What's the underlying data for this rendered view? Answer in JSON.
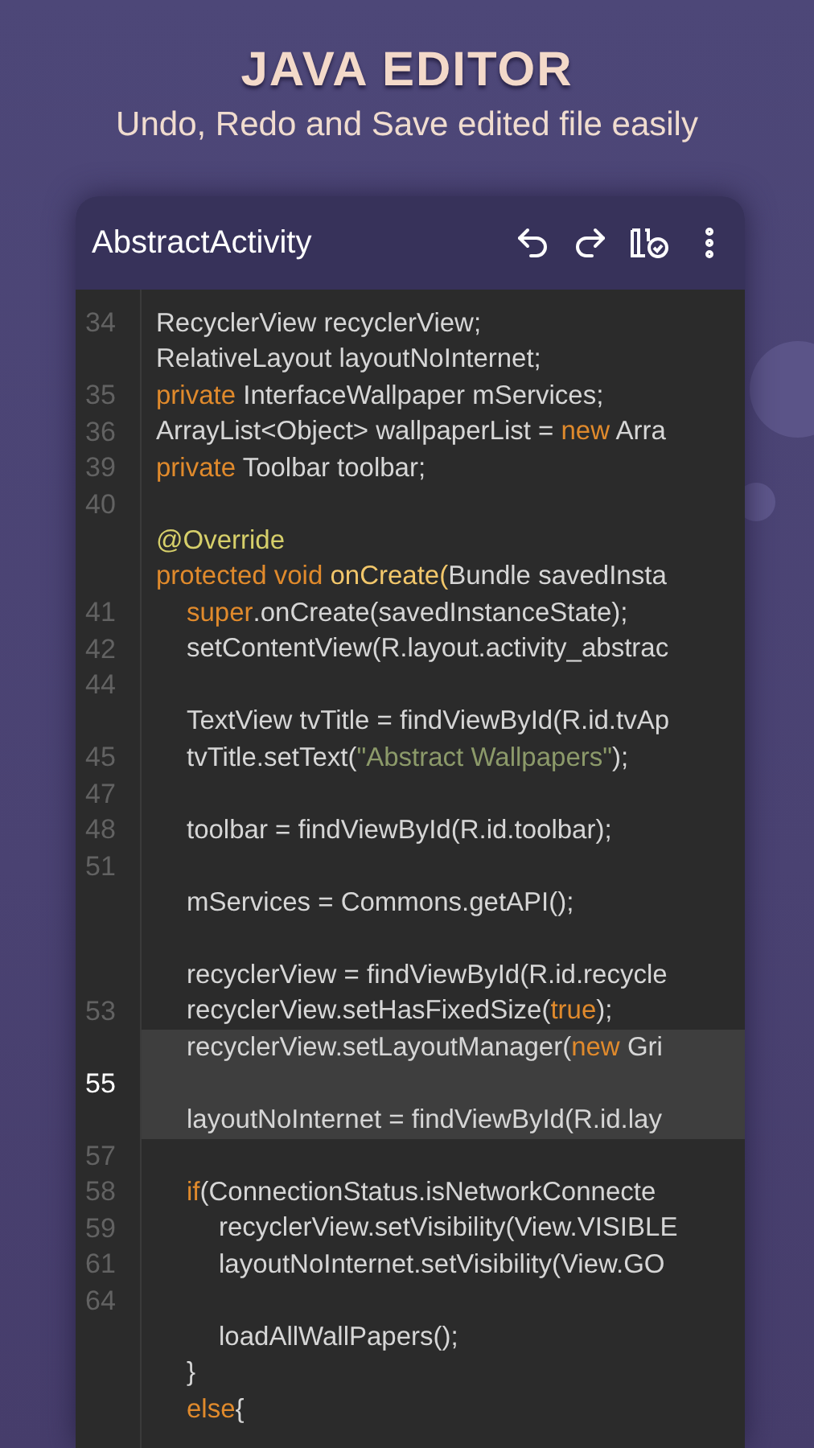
{
  "heading": {
    "title": "JAVA EDITOR",
    "subtitle": "Undo, Redo and Save edited file easily"
  },
  "editor": {
    "title": "AbstractActivity",
    "lines": [
      {
        "number": "34",
        "kind": "outer",
        "highlighted": false,
        "tokens": [
          {
            "kind": "plain",
            "text": "RecyclerView recyclerView;"
          }
        ]
      },
      {
        "kind": "outer",
        "highlighted": false,
        "tokens": [
          {
            "kind": "plain",
            "text": "RelativeLayout layoutNoInternet;"
          }
        ]
      },
      {
        "number": "35",
        "kind": "outer",
        "highlighted": false,
        "tokens": [
          {
            "kind": "keyword",
            "text": "private"
          },
          {
            "kind": "plain",
            "text": " InterfaceWallpaper mServices;"
          }
        ]
      },
      {
        "number": "36",
        "kind": "outer",
        "highlighted": false,
        "tokens": [
          {
            "kind": "plain",
            "text": "ArrayList<Object> wallpaperList = "
          },
          {
            "kind": "keyword",
            "text": "new"
          },
          {
            "kind": "plain",
            "text": " Arra"
          }
        ]
      },
      {
        "number": "39",
        "kind": "outer",
        "highlighted": false,
        "tokens": [
          {
            "kind": "keyword",
            "text": "private"
          },
          {
            "kind": "plain",
            "text": " Toolbar toolbar;"
          }
        ]
      },
      {
        "number": "40",
        "kind": "outer",
        "highlighted": false
      },
      {
        "kind": "outer",
        "highlighted": false,
        "tokens": [
          {
            "kind": "annotation",
            "text": "@Override"
          }
        ]
      },
      {
        "kind": "outer",
        "highlighted": false,
        "tokens": [
          {
            "kind": "keyword",
            "text": "protected void "
          },
          {
            "kind": "method",
            "text": "onCreate("
          },
          {
            "kind": "plain",
            "text": "Bundle savedInsta"
          }
        ]
      },
      {
        "number": "41",
        "kind": "body",
        "highlighted": false,
        "tokens": [
          {
            "kind": "keyword",
            "text": "super"
          },
          {
            "kind": "plain",
            "text": ".onCreate(savedInstanceState);"
          }
        ]
      },
      {
        "number": "42",
        "kind": "body",
        "highlighted": false,
        "tokens": [
          {
            "kind": "plain",
            "text": "setContentView(R.layout.activity_abstrac"
          }
        ]
      },
      {
        "number": "44",
        "kind": "body",
        "highlighted": false
      },
      {
        "kind": "body",
        "highlighted": false,
        "tokens": [
          {
            "kind": "plain",
            "text": "TextView tvTitle = findViewById(R.id.tvAp"
          }
        ]
      },
      {
        "number": "45",
        "kind": "body",
        "highlighted": false,
        "tokens": [
          {
            "kind": "plain",
            "text": "tvTitle.setText("
          },
          {
            "kind": "string",
            "text": "\"Abstract Wallpapers\""
          },
          {
            "kind": "plain",
            "text": ");"
          }
        ]
      },
      {
        "number": "47",
        "kind": "body",
        "highlighted": false
      },
      {
        "number": "48",
        "kind": "body",
        "highlighted": false,
        "tokens": [
          {
            "kind": "plain",
            "text": "toolbar = findViewById(R.id.toolbar);"
          }
        ]
      },
      {
        "number": "51",
        "kind": "body",
        "highlighted": false
      },
      {
        "kind": "body",
        "highlighted": false,
        "tokens": [
          {
            "kind": "plain",
            "text": "mServices = Commons.getAPI();"
          }
        ]
      },
      {
        "kind": "body",
        "highlighted": false
      },
      {
        "kind": "body",
        "highlighted": false,
        "tokens": [
          {
            "kind": "plain",
            "text": "recyclerView = findViewById(R.id.recycle"
          }
        ]
      },
      {
        "number": "53",
        "kind": "body",
        "highlighted": false,
        "tokens": [
          {
            "kind": "plain",
            "text": "recyclerView.setHasFixedSize("
          },
          {
            "kind": "keyword",
            "text": "true"
          },
          {
            "kind": "plain",
            "text": ");"
          }
        ]
      },
      {
        "kind": "body",
        "highlighted": true,
        "tokens": [
          {
            "kind": "plain",
            "text": "recyclerView.setLayoutManager("
          },
          {
            "kind": "keyword",
            "text": "new"
          },
          {
            "kind": "plain",
            "text": " Gri"
          }
        ]
      },
      {
        "number": "55",
        "kind": "body",
        "highlighted": true
      },
      {
        "kind": "body",
        "highlighted": true,
        "tokens": [
          {
            "kind": "plain",
            "text": "layoutNoInternet = findViewById(R.id.lay"
          }
        ]
      },
      {
        "number": "57",
        "kind": "body",
        "highlighted": false
      },
      {
        "number": "58",
        "kind": "body",
        "highlighted": false,
        "tokens": [
          {
            "kind": "keyword",
            "text": "if"
          },
          {
            "kind": "plain",
            "text": "(ConnectionStatus.isNetworkConnecte"
          }
        ]
      },
      {
        "number": "59",
        "kind": "nested",
        "highlighted": false,
        "tokens": [
          {
            "kind": "plain",
            "text": "recyclerView.setVisibility(View.VISIBLE"
          }
        ]
      },
      {
        "number": "61",
        "kind": "nested",
        "highlighted": false,
        "tokens": [
          {
            "kind": "plain",
            "text": "layoutNoInternet.setVisibility(View.GO"
          }
        ]
      },
      {
        "number": "64",
        "kind": "nested",
        "highlighted": false
      },
      {
        "kind": "nested",
        "highlighted": false,
        "tokens": [
          {
            "kind": "plain",
            "text": "loadAllWallPapers();"
          }
        ]
      },
      {
        "kind": "body",
        "highlighted": false,
        "tokens": [
          {
            "kind": "plain",
            "text": "}"
          }
        ]
      },
      {
        "kind": "body",
        "highlighted": false,
        "tokens": [
          {
            "kind": "keyword",
            "text": "else"
          },
          {
            "kind": "plain",
            "text": "{"
          }
        ]
      }
    ]
  }
}
